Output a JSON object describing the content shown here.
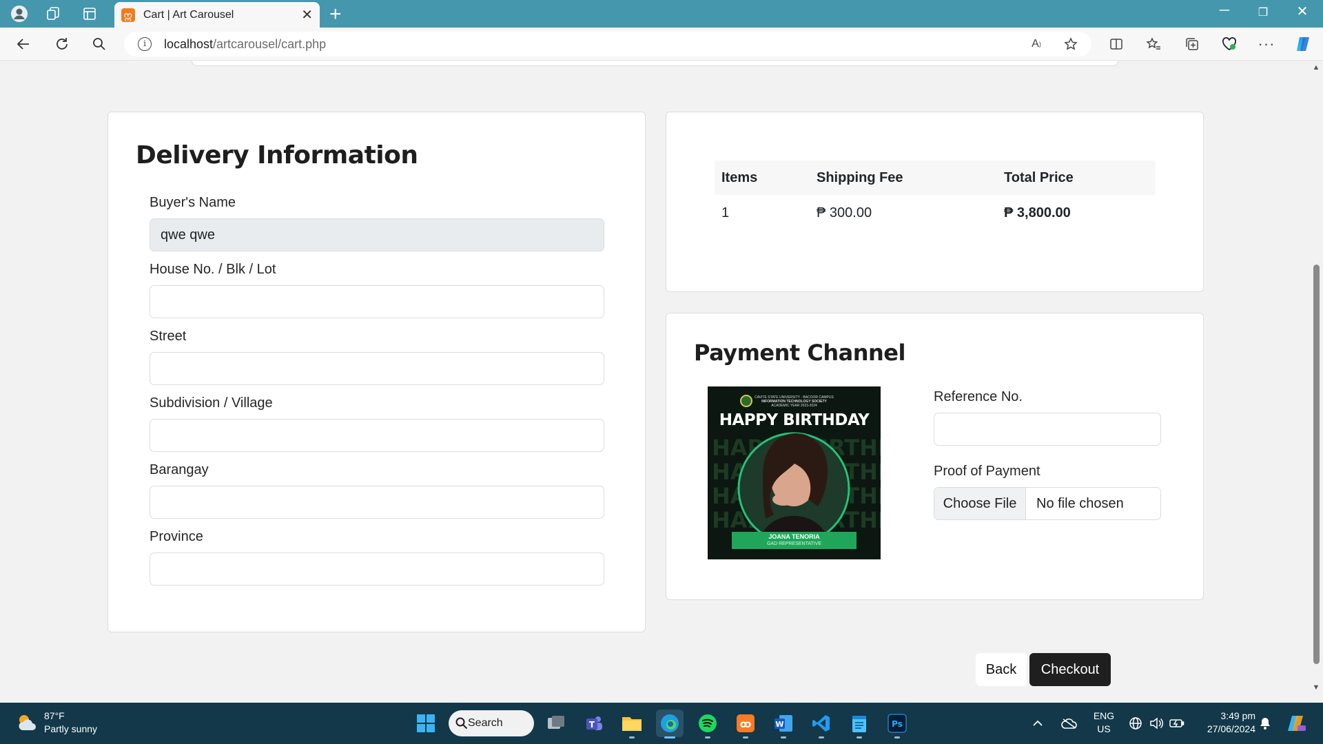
{
  "browser": {
    "tab_title": "Cart | Art Carousel",
    "tab_favicon": "xampp-icon",
    "url_host": "localhost",
    "url_path": "/artcarousel/cart.php"
  },
  "delivery": {
    "title": "Delivery Information",
    "fields": [
      {
        "label": "Buyer's Name",
        "value": "qwe qwe"
      },
      {
        "label": "House No. / Blk / Lot",
        "value": ""
      },
      {
        "label": "Street",
        "value": ""
      },
      {
        "label": "Subdivision / Village",
        "value": ""
      },
      {
        "label": "Barangay",
        "value": ""
      },
      {
        "label": "Province",
        "value": ""
      }
    ]
  },
  "summary": {
    "headers": [
      "Items",
      "Shipping Fee",
      "Total Price"
    ],
    "row": {
      "items": "1",
      "shipping_fee": "₱ 300.00",
      "total_price": "₱ 3,800.00"
    }
  },
  "payment": {
    "title": "Payment Channel",
    "poster": {
      "org_line1": "CAVITE STATE UNIVERSITY - BACOOR CAMPUS",
      "org_line2": "INFORMATION TECHNOLOGY SOCIETY",
      "org_line3": "ACADEMIC YEAR 2023-2024",
      "headline": "HAPPY BIRTHDAY",
      "name": "JOANA TENORIA",
      "role": "GAD REPRESENTATIVE"
    },
    "reference_label": "Reference No.",
    "reference_value": "",
    "proof_label": "Proof of Payment",
    "choose_file": "Choose File",
    "file_status": "No file chosen"
  },
  "actions": {
    "back": "Back",
    "checkout": "Checkout"
  },
  "taskbar": {
    "temperature": "87°F",
    "weather": "Partly sunny",
    "search": "Search",
    "lang": "ENG",
    "region": "US",
    "time": "3:49 pm",
    "date": "27/06/2024"
  },
  "colors": {
    "titlebar": "#4597ad",
    "taskbar": "#12384a",
    "checkout_button": "#1f1f1f",
    "poster_green": "#1fa65a"
  }
}
